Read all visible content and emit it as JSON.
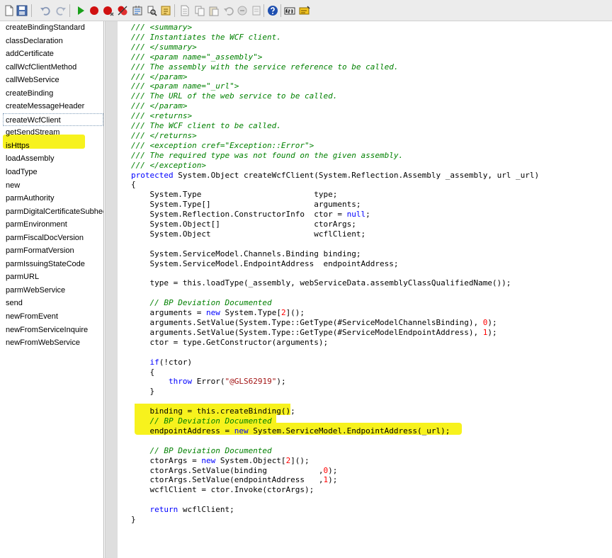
{
  "toolbar": {
    "icons": [
      "new-icon",
      "save-icon",
      "undo-icon",
      "redo-icon",
      "run-icon",
      "breakpoint-icon",
      "remove-breakpoint-icon",
      "clear-breakpoints-icon",
      "compile-icon",
      "lookup-icon",
      "properties-icon",
      "new-method-icon",
      "copy-icon",
      "paste-icon",
      "undo-edit-icon",
      "comment-icon",
      "uncomment-icon",
      "help-icon",
      "label-editor-icon",
      "script-icon"
    ]
  },
  "methods": [
    "createBindingStandard",
    "classDeclaration",
    "addCertificate",
    "callWcfClientMethod",
    "callWebService",
    "createBinding",
    "createMessageHeader",
    "createWcfClient",
    "getSendStream",
    "isHttps",
    "loadAssembly",
    "loadType",
    "new",
    "parmAuthority",
    "parmDigitalCertificateSubhect",
    "parmEnvironment",
    "parmFiscalDocVersion",
    "parmFormatVersion",
    "parmIssuingStateCode",
    "parmURL",
    "parmWebService",
    "send",
    "newFromEvent",
    "newFromServiceInquire",
    "newFromWebService"
  ],
  "selected_method_index": 7,
  "code": {
    "lines": [
      [
        [
          "/// <summary>",
          "cm"
        ]
      ],
      [
        [
          "/// Instantiates the WCF client.",
          "cm"
        ]
      ],
      [
        [
          "/// </summary>",
          "cm"
        ]
      ],
      [
        [
          "/// <param name=\"_assembly\">",
          "cm"
        ]
      ],
      [
        [
          "/// The assembly with the service reference to be called.",
          "cm"
        ]
      ],
      [
        [
          "/// </param>",
          "cm"
        ]
      ],
      [
        [
          "/// <param name=\"_url\">",
          "cm"
        ]
      ],
      [
        [
          "/// The URL of the web service to be called.",
          "cm"
        ]
      ],
      [
        [
          "/// </param>",
          "cm"
        ]
      ],
      [
        [
          "/// <returns>",
          "cm"
        ]
      ],
      [
        [
          "/// The WCF client to be called.",
          "cm"
        ]
      ],
      [
        [
          "/// </returns>",
          "cm"
        ]
      ],
      [
        [
          "/// <exception cref=\"Exception::Error\">",
          "cm"
        ]
      ],
      [
        [
          "/// The required type was not found on the given assembly.",
          "cm"
        ]
      ],
      [
        [
          "/// </exception>",
          "cm"
        ]
      ],
      [
        [
          "protected",
          "kw"
        ],
        [
          " System.Object createWcfClient(System.Reflection.Assembly _assembly, url _url)",
          ""
        ]
      ],
      [
        [
          "{",
          ""
        ]
      ],
      [
        [
          "    System.Type                        type;",
          ""
        ]
      ],
      [
        [
          "    System.Type[]                      arguments;",
          ""
        ]
      ],
      [
        [
          "    System.Reflection.ConstructorInfo  ctor = ",
          ""
        ],
        [
          "null",
          "kw"
        ],
        [
          ";",
          ""
        ]
      ],
      [
        [
          "    System.Object[]                    ctorArgs;",
          ""
        ]
      ],
      [
        [
          "    System.Object                      wcflClient;",
          ""
        ]
      ],
      [
        [
          "",
          ""
        ]
      ],
      [
        [
          "    System.ServiceModel.Channels.Binding binding;",
          ""
        ]
      ],
      [
        [
          "    System.ServiceModel.EndpointAddress  endpointAddress;",
          ""
        ]
      ],
      [
        [
          "",
          ""
        ]
      ],
      [
        [
          "    type = this.loadType(_assembly, webServiceData.assemblyClassQualifiedName());",
          ""
        ]
      ],
      [
        [
          "",
          ""
        ]
      ],
      [
        [
          "    // BP Deviation Documented",
          "cm"
        ]
      ],
      [
        [
          "    arguments = ",
          ""
        ],
        [
          "new",
          "kw"
        ],
        [
          " System.Type[",
          ""
        ],
        [
          "2",
          "num"
        ],
        [
          "]();",
          ""
        ]
      ],
      [
        [
          "    arguments.SetValue(System.Type::GetType(#ServiceModelChannelsBinding), ",
          ""
        ],
        [
          "0",
          "num"
        ],
        [
          ");",
          ""
        ]
      ],
      [
        [
          "    arguments.SetValue(System.Type::GetType(#ServiceModelEndpointAddress), ",
          ""
        ],
        [
          "1",
          "num"
        ],
        [
          ");",
          ""
        ]
      ],
      [
        [
          "    ctor = type.GetConstructor(arguments);",
          ""
        ]
      ],
      [
        [
          "",
          ""
        ]
      ],
      [
        [
          "    ",
          ""
        ],
        [
          "if",
          "kw"
        ],
        [
          "(!ctor)",
          ""
        ]
      ],
      [
        [
          "    {",
          ""
        ]
      ],
      [
        [
          "        ",
          ""
        ],
        [
          "throw",
          "kw"
        ],
        [
          " Error(",
          ""
        ],
        [
          "\"@GLS62919\"",
          "str"
        ],
        [
          ");",
          ""
        ]
      ],
      [
        [
          "    }",
          ""
        ]
      ],
      [
        [
          "",
          ""
        ]
      ],
      [
        [
          "    binding = this.createBinding();",
          ""
        ]
      ],
      [
        [
          "    // BP Deviation Documented",
          "cm"
        ]
      ],
      [
        [
          "    endpointAddress = ",
          ""
        ],
        [
          "new",
          "kw"
        ],
        [
          " System.ServiceModel.EndpointAddress(_url);",
          ""
        ]
      ],
      [
        [
          "",
          ""
        ]
      ],
      [
        [
          "    // BP Deviation Documented",
          "cm"
        ]
      ],
      [
        [
          "    ctorArgs = ",
          ""
        ],
        [
          "new",
          "kw"
        ],
        [
          " System.Object[",
          ""
        ],
        [
          "2",
          "num"
        ],
        [
          "]();",
          ""
        ]
      ],
      [
        [
          "    ctorArgs.SetValue(binding           ,",
          ""
        ],
        [
          "0",
          "num"
        ],
        [
          ");",
          ""
        ]
      ],
      [
        [
          "    ctorArgs.SetValue(endpointAddress   ,",
          ""
        ],
        [
          "1",
          "num"
        ],
        [
          ");",
          ""
        ]
      ],
      [
        [
          "    wcflClient = ctor.Invoke(ctorArgs);",
          ""
        ]
      ],
      [
        [
          "",
          ""
        ]
      ],
      [
        [
          "    ",
          ""
        ],
        [
          "return",
          "kw"
        ],
        [
          " wcflClient;",
          ""
        ]
      ],
      [
        [
          "}",
          ""
        ]
      ]
    ]
  }
}
